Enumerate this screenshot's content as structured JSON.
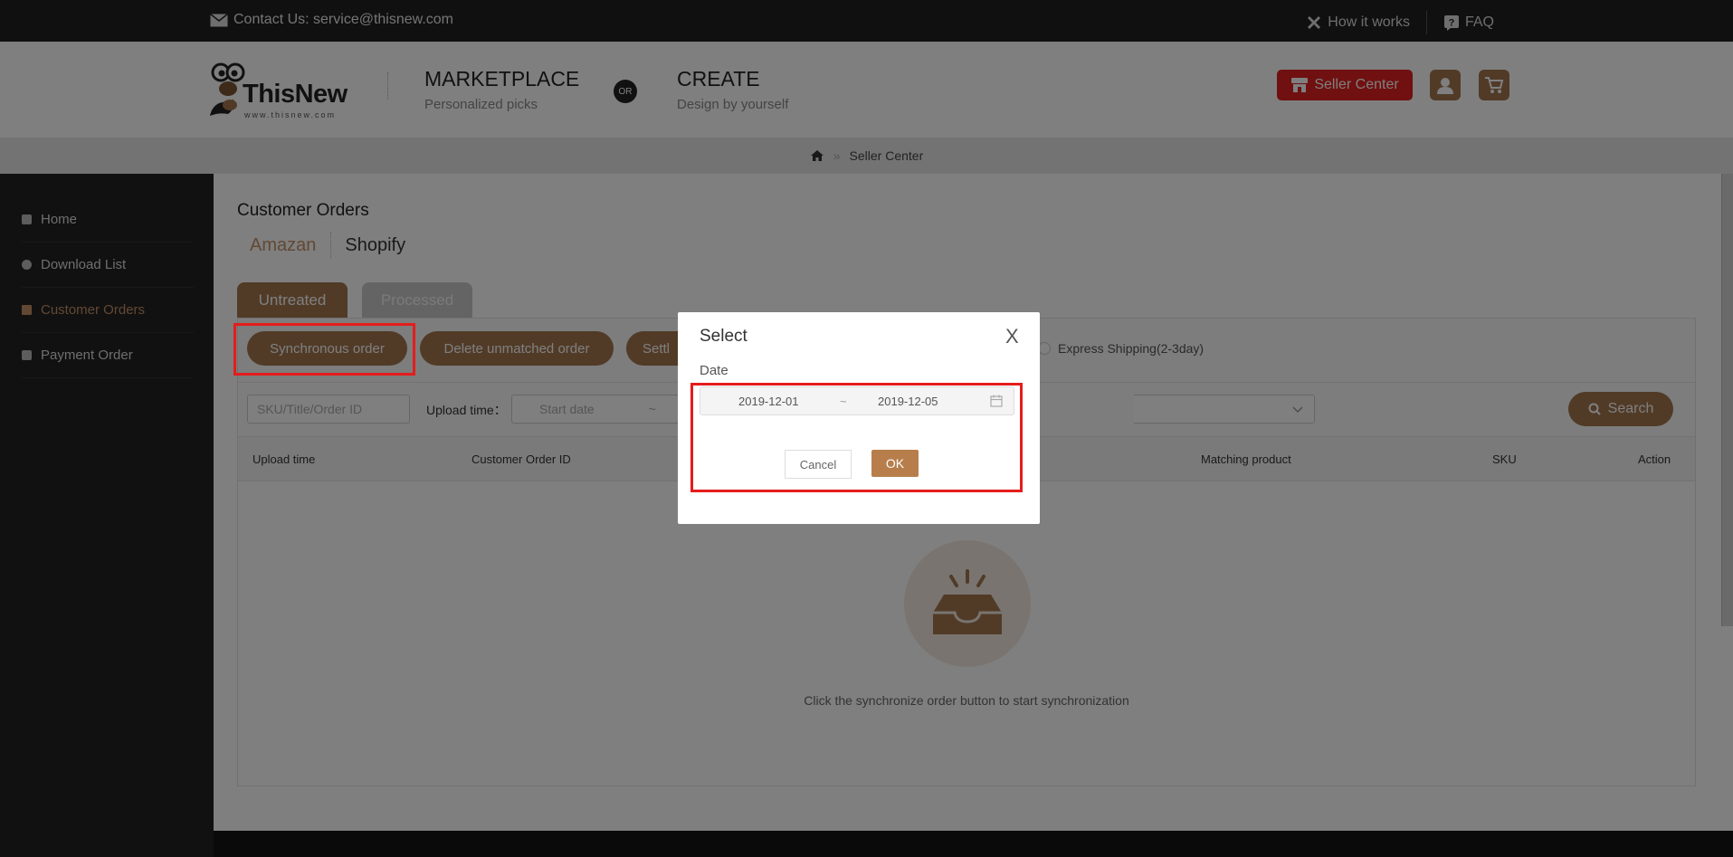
{
  "topbar": {
    "contact": "Contact Us: service@thisnew.com",
    "how_it_works": "How it works",
    "faq": "FAQ"
  },
  "header": {
    "logo_text": "ThisNew",
    "logo_url": "www.thisnew.com",
    "marketplace_title": "MARKETPLACE",
    "marketplace_sub": "Personalized picks",
    "or_label": "OR",
    "create_title": "CREATE",
    "create_sub": "Design by yourself",
    "seller_center_btn": "Seller Center"
  },
  "breadcrumb": {
    "separator": "»",
    "current": "Seller Center"
  },
  "sidebar": {
    "items": [
      {
        "label": "Home",
        "active": false
      },
      {
        "label": "Download List",
        "active": false
      },
      {
        "label": "Customer Orders",
        "active": true
      },
      {
        "label": "Payment Order",
        "active": false
      }
    ]
  },
  "main": {
    "title": "Customer Orders",
    "platforms": [
      "Amazan",
      "Shopify"
    ],
    "status_tabs": [
      "Untreated",
      "Processed"
    ],
    "actions": {
      "sync": "Synchronous order",
      "delete": "Delete unmatched order",
      "settle": "Settl"
    },
    "express_label": "Express Shipping(2-3day)",
    "filters": {
      "sku_placeholder": "SKU/Title/Order ID",
      "upload_time_label": "Upload time：",
      "start_date_placeholder": "Start date",
      "tilde": "~",
      "search_btn": "Search"
    },
    "table_headers": [
      "Upload time",
      "Customer Order ID",
      "Matching product",
      "SKU",
      "Action"
    ],
    "empty_text": "Click the synchronize order button to start synchronization"
  },
  "modal": {
    "title": "Select",
    "close": "X",
    "date_label": "Date",
    "start_date": "2019-12-01",
    "tilde": "~",
    "end_date": "2019-12-05",
    "cancel": "Cancel",
    "ok": "OK"
  },
  "colors": {
    "accent": "#a3764f",
    "ok_button": "#b77e4c",
    "seller_red": "#e02020",
    "highlight": "#e51c1c",
    "active_tab_text": "#c49066"
  }
}
